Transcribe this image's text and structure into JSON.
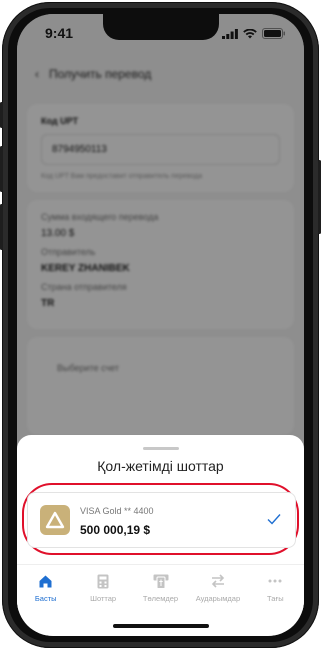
{
  "status_bar": {
    "time": "9:41"
  },
  "background": {
    "header_title": "Получить перевод",
    "code_card": {
      "label": "Код UPT",
      "code_value": "8794950113",
      "hint": "Код UPT Вам предоставит отправитель перевода"
    },
    "details_card": {
      "amount_label": "Сумма входящего перевода",
      "amount_value": "13.00 $",
      "sender_label": "Отправитель",
      "sender_value": "KEREY ZHANIBEK",
      "country_label": "Страна отправителя",
      "country_value": "TR"
    },
    "third_card_text": "Выберите счет"
  },
  "sheet": {
    "title": "Қол-жетімді шоттар",
    "account": {
      "name": "VISA Gold ** 4400",
      "balance": "500 000,19 $",
      "selected": true
    }
  },
  "tabbar": {
    "items": [
      {
        "label": "Басты",
        "icon": "home-icon",
        "active": true
      },
      {
        "label": "Шоттар",
        "icon": "accounts-icon",
        "active": false
      },
      {
        "label": "Төлемдер",
        "icon": "payments-icon",
        "active": false
      },
      {
        "label": "Аударымдар",
        "icon": "transfers-icon",
        "active": false
      },
      {
        "label": "Тағы",
        "icon": "more-icon",
        "active": false
      }
    ]
  },
  "colors": {
    "accent": "#1f6fd1",
    "highlight": "#e0102b",
    "card_logo": "#c9b179"
  }
}
